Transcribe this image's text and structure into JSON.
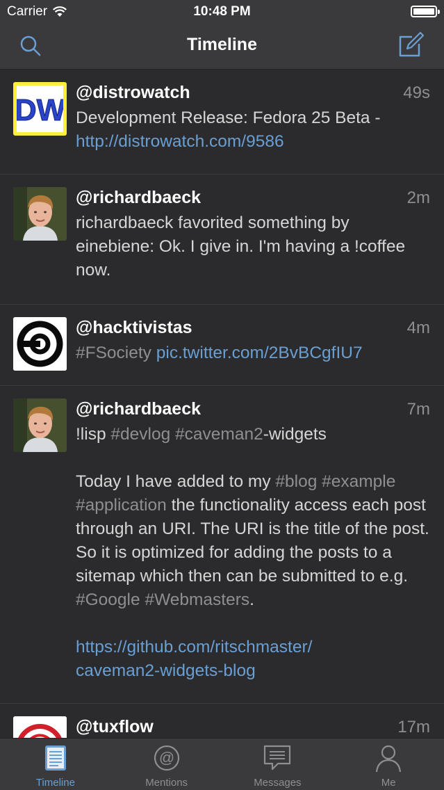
{
  "status_bar": {
    "carrier": "Carrier",
    "time": "10:48 PM"
  },
  "nav": {
    "title": "Timeline",
    "left_icon": "search-icon",
    "right_icon": "compose-icon"
  },
  "tweets": [
    {
      "handle": "@distrowatch",
      "time": "49s",
      "avatar": "distrowatch-logo",
      "body": [
        {
          "t": "Development Release: Fedora 25 Beta - ",
          "k": "text"
        },
        {
          "t": "http://distrowatch.com/9586",
          "k": "link"
        }
      ]
    },
    {
      "handle": "@richardbaeck",
      "time": "2m",
      "avatar": "person-photo",
      "body": [
        {
          "t": "richardbaeck favorited something by einebiene: Ok. I give in. I'm having a !coffee now.",
          "k": "text"
        }
      ]
    },
    {
      "handle": "@hacktivistas",
      "time": "4m",
      "avatar": "copyleft-logo",
      "body": [
        {
          "t": "#FSociety",
          "k": "tag"
        },
        {
          "t": " ",
          "k": "text"
        },
        {
          "t": "pic.twitter.com/2BvBCgfIU7",
          "k": "link"
        }
      ]
    },
    {
      "handle": "@richardbaeck",
      "time": "7m",
      "avatar": "person-photo",
      "body": [
        {
          "t": "!lisp ",
          "k": "text"
        },
        {
          "t": "#devlog",
          "k": "tag"
        },
        {
          "t": " ",
          "k": "text"
        },
        {
          "t": "#caveman2",
          "k": "tag"
        },
        {
          "t": "-widgets\n\nToday I have added to my ",
          "k": "text"
        },
        {
          "t": "#blog",
          "k": "tag"
        },
        {
          "t": " ",
          "k": "text"
        },
        {
          "t": "#example",
          "k": "tag"
        },
        {
          "t": " ",
          "k": "text"
        },
        {
          "t": "#application",
          "k": "tag"
        },
        {
          "t": " the functionality access each post through an URI. The URI is the title of the post. So it is optimized for adding the posts to a sitemap which then can be submitted to e.g. ",
          "k": "text"
        },
        {
          "t": "#Google",
          "k": "tag"
        },
        {
          "t": " ",
          "k": "text"
        },
        {
          "t": "#Webmasters",
          "k": "tag"
        },
        {
          "t": ".\n\n",
          "k": "text"
        },
        {
          "t": "https://github.com/ritschmaster/\ncaveman2-widgets-blog",
          "k": "link"
        }
      ]
    },
    {
      "handle": "@tuxflow",
      "time": "17m",
      "avatar": "tuxflow-logo",
      "body": []
    }
  ],
  "tabs": [
    {
      "label": "Timeline",
      "icon": "timeline-icon",
      "active": true
    },
    {
      "label": "Mentions",
      "icon": "at-icon",
      "active": false
    },
    {
      "label": "Messages",
      "icon": "messages-icon",
      "active": false
    },
    {
      "label": "Me",
      "icon": "person-icon",
      "active": false
    }
  ],
  "colors": {
    "background": "#2b2b2d",
    "bars": "#3a3a3c",
    "link": "#6a9fd4",
    "tag": "#8e8e93"
  }
}
